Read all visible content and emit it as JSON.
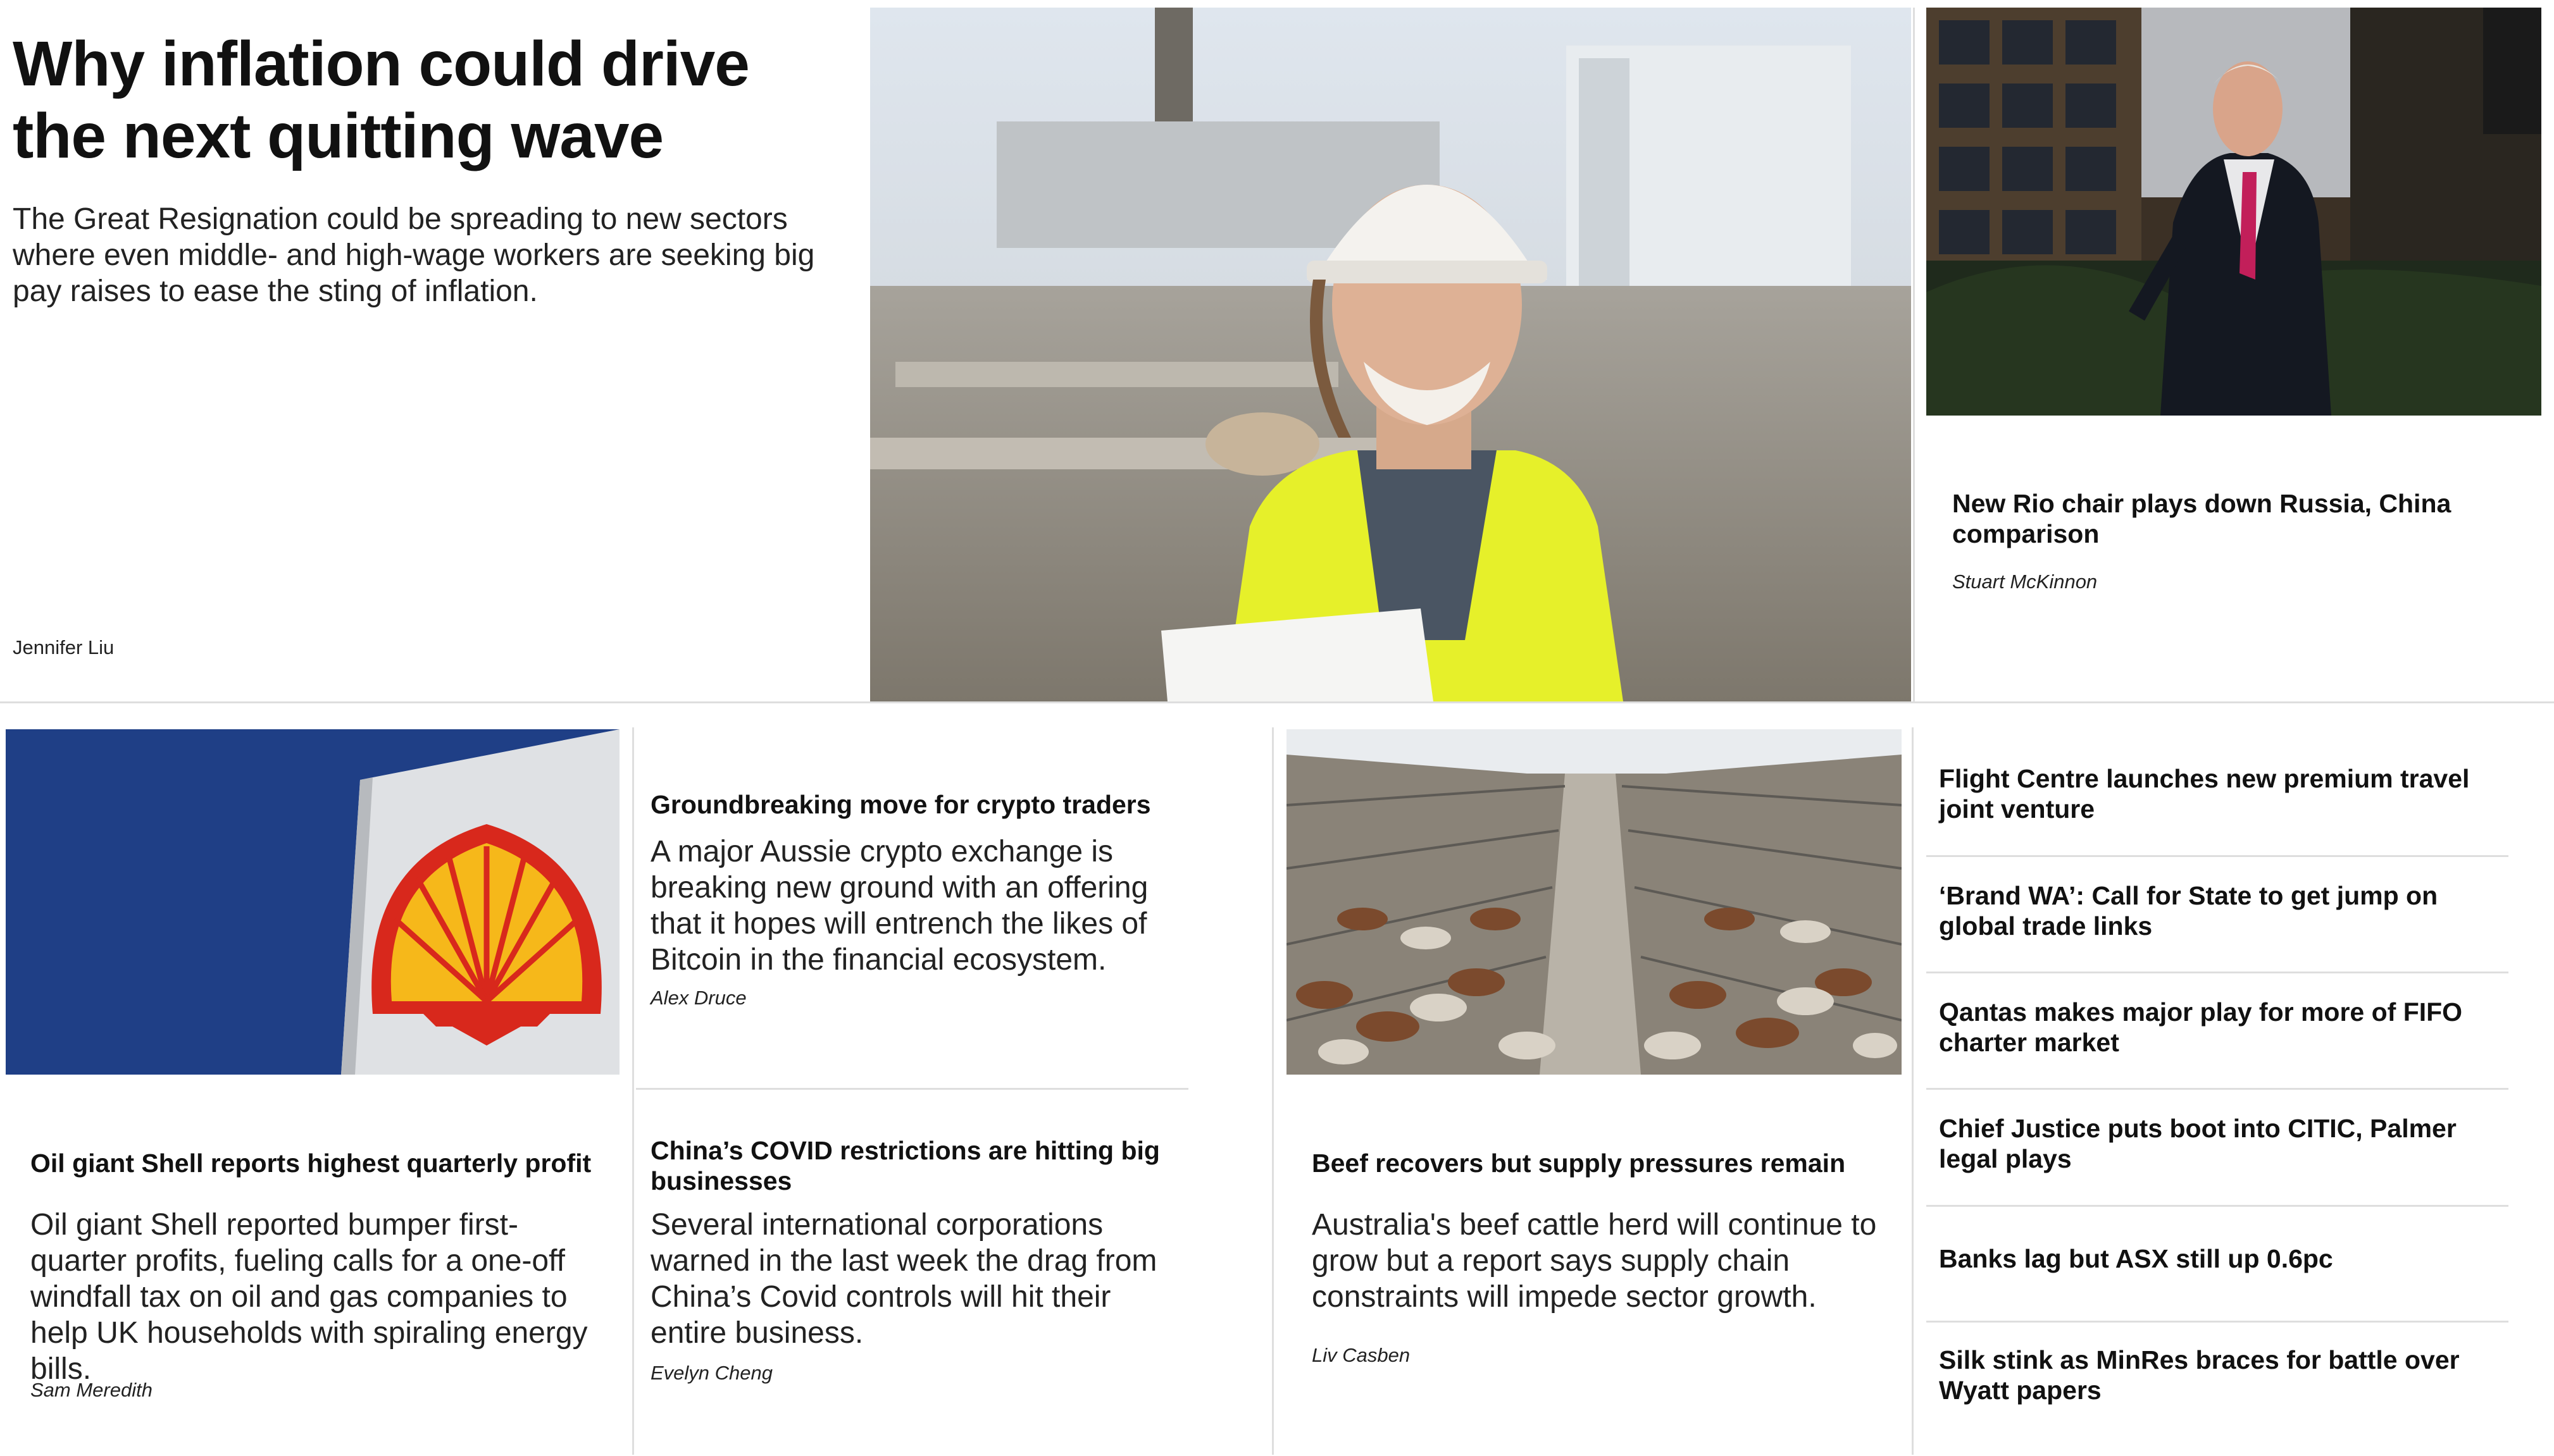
{
  "feature": {
    "headline": "Why inflation could drive the next quitting wave",
    "summary": "The Great Resignation could be spreading to new sectors where even middle- and high-wage workers are seeking big pay raises to ease the sting of inflation.",
    "byline": "Jennifer Liu",
    "image_alt": "smiling-worker-in-hard-hat-and-hi-vis-vest"
  },
  "top_right": {
    "headline": "New Rio chair plays down Russia, China comparison",
    "byline": "Stuart McKinnon",
    "image_alt": "man-in-suit-in-office-atrium"
  },
  "cards": [
    {
      "headline": "Oil giant Shell reports highest quarterly profit",
      "summary": "Oil giant Shell reported bumper first-quarter profits, fueling calls for a one-off windfall tax on oil and gas companies to help UK households with spiraling energy bills.",
      "byline": "Sam Meredith",
      "image_alt": "shell-logo-sign"
    },
    {
      "headline": "Groundbreaking move for crypto traders",
      "summary": "A major Aussie crypto exchange is breaking new ground with an offering that it hopes will entrench the likes of Bitcoin in the financial ecosystem.",
      "byline": "Alex Druce"
    },
    {
      "headline": "China’s COVID restrictions are hitting big businesses",
      "summary": "Several international corporations warned in the last week the drag from China’s Covid controls will hit their entire business.",
      "byline": "Evelyn Cheng"
    },
    {
      "headline": "Beef recovers but supply pressures remain",
      "summary": "Australia's beef cattle herd will continue to grow but a report says supply chain constraints will impede sector growth.",
      "byline": "Liv Casben",
      "image_alt": "cattle-in-saleyard-pens"
    }
  ],
  "headlines_list": [
    "Flight Centre launches new premium travel joint venture",
    "‘Brand WA’: Call for State to get jump on global trade links",
    "Qantas makes major play for more of FIFO charter market",
    "Chief Justice puts boot into CITIC, Palmer legal plays",
    "Banks lag but ASX still up 0.6pc",
    "Silk stink as MinRes braces for battle over Wyatt papers"
  ],
  "colors": {
    "divider": "#dedede",
    "shell_red": "#d8281c",
    "shell_yellow": "#f6b81a",
    "hivis_yellow": "#e6f02a",
    "sky_blue": "#1f3f86"
  }
}
